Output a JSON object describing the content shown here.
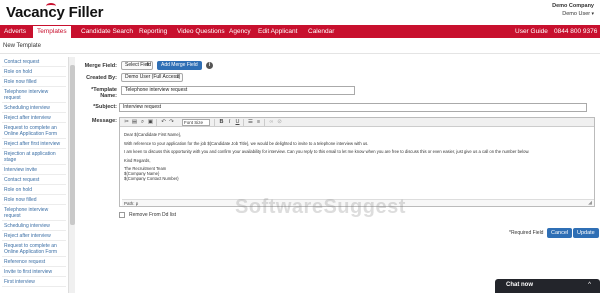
{
  "app": {
    "logo_text": "Vacancy Filler",
    "company": "Demo Company",
    "user": "Demo User"
  },
  "nav": {
    "items": [
      {
        "label": "Adverts"
      },
      {
        "label": "Templates"
      },
      {
        "label": "Candidate Search"
      },
      {
        "label": "Reporting"
      },
      {
        "label": "Video Questions"
      },
      {
        "label": "Agency"
      },
      {
        "label": "Edit Applicant"
      },
      {
        "label": "Calendar"
      }
    ],
    "user_guide": "User Guide",
    "phone": "0844 800 9376"
  },
  "page": {
    "title": "New Template"
  },
  "sidebar": {
    "items": [
      {
        "label": "Contact request"
      },
      {
        "label": "Role on hold"
      },
      {
        "label": "Role now filled"
      },
      {
        "label": "Telephone interview request"
      },
      {
        "label": "Scheduling interview"
      },
      {
        "label": "Reject after interview"
      },
      {
        "label": "Request to complete an Online Application Form"
      },
      {
        "label": "Reject after first interview"
      },
      {
        "label": "Rejection at application stage"
      },
      {
        "label": "Interview invite"
      },
      {
        "label": "Contact request"
      },
      {
        "label": "Role on hold"
      },
      {
        "label": "Role now filled"
      },
      {
        "label": "Telephone interview request"
      },
      {
        "label": "Scheduling interview"
      },
      {
        "label": "Reject after interview"
      },
      {
        "label": "Request to complete an Online Application Form"
      },
      {
        "label": "Reference request"
      },
      {
        "label": "Invite to first interview"
      },
      {
        "label": "First interview"
      }
    ]
  },
  "form": {
    "merge_field_label": "Merge Field:",
    "merge_field_value": "Select Field",
    "add_merge_field_label": "Add Merge Field",
    "created_by_label": "Created By:",
    "created_by_value": "Demo User (Full Access)",
    "template_name_label": "*Template Name:",
    "template_name_value": "Telephone interview request",
    "subject_label": "*Subject:",
    "subject_value": "Interview request",
    "message_label": "Message:",
    "font_size_value": "Font Size",
    "message_lines": [
      "Dear ${Candidate First Name},",
      "With reference to your application for the job ${Candidate Job Title}, we would be delighted to invite to a telephone interview with us.",
      "I am keen to discuss this opportunity with you and confirm your availability for interview. Can you reply to this email to let me know when you are free to discuss this or even easier, just give us a call on the number below.",
      "Kind Regards,",
      "The Recruitment Team",
      "${Company Name}",
      "${Company Contact Number}"
    ],
    "editor_path": "Path: p",
    "remove_checkbox_label": "Remove From Dd list",
    "required_note": "*Required Field",
    "cancel_label": "Cancel",
    "update_label": "Update"
  },
  "watermark": "SoftwareSuggest",
  "chat": {
    "label": "Chat now",
    "caret": "^"
  }
}
